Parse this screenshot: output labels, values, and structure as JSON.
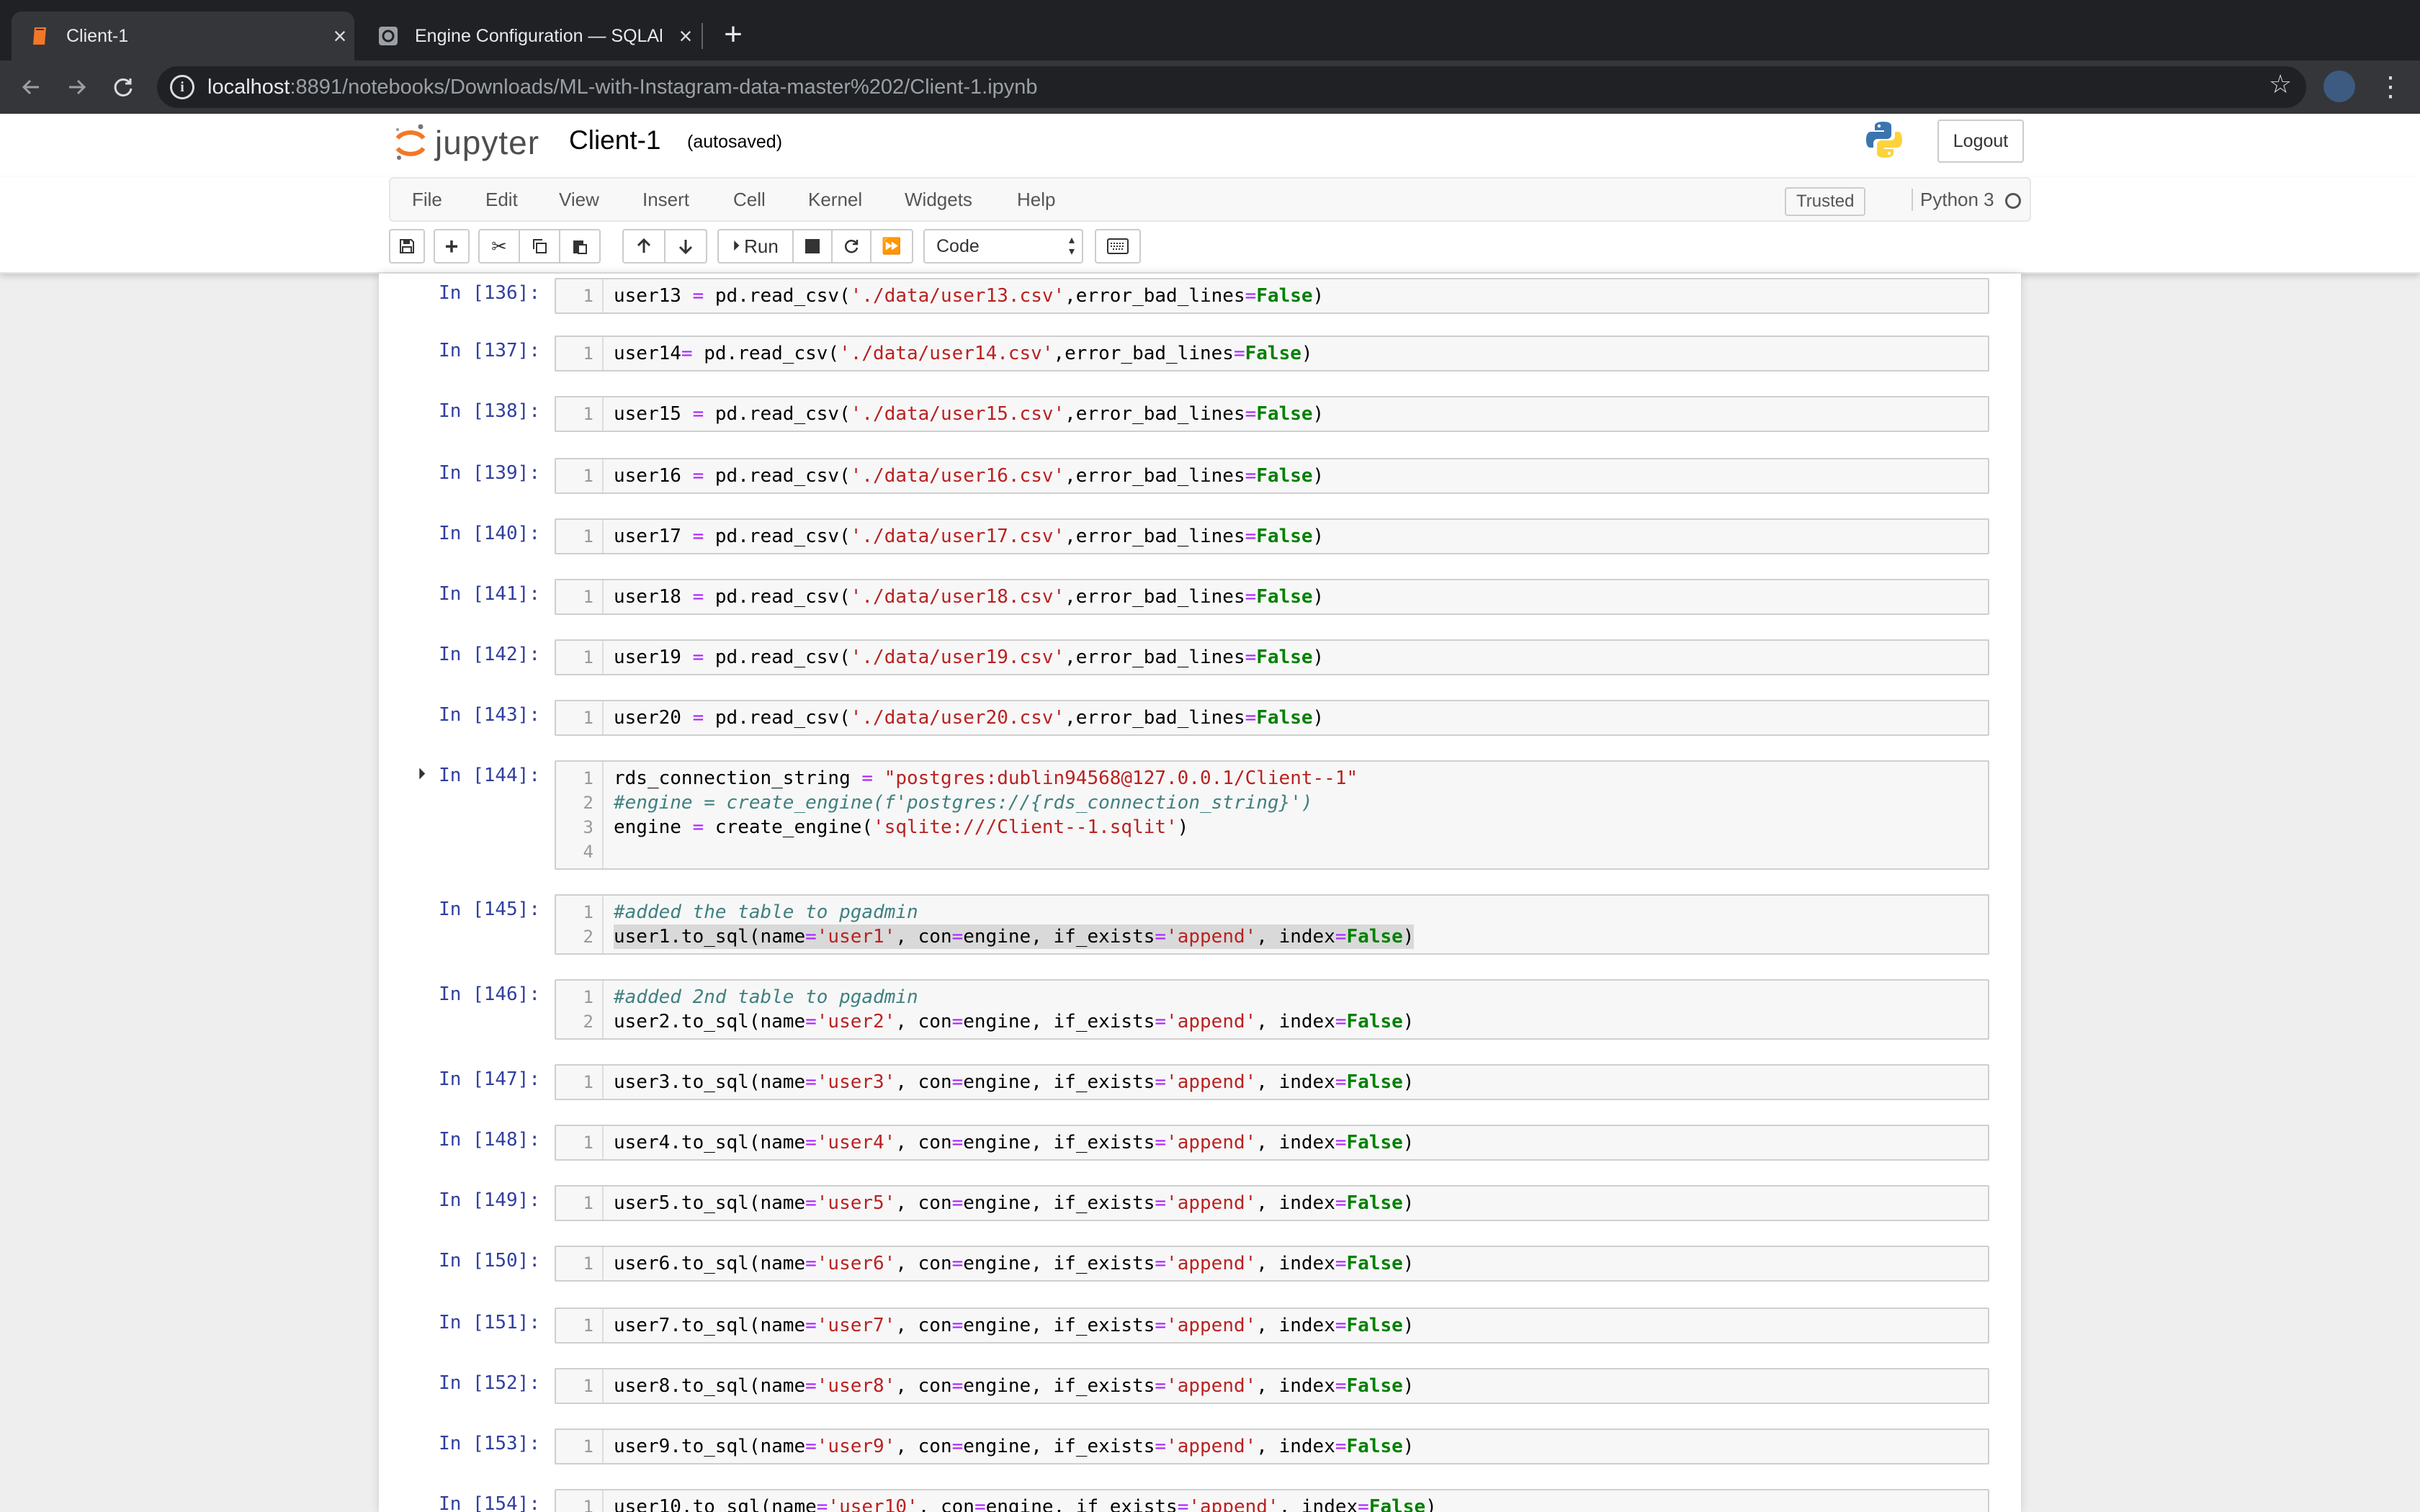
{
  "browser": {
    "tabs": [
      {
        "title": "Client-1",
        "active": true
      },
      {
        "title": "Engine Configuration — SQLAl",
        "active": false
      }
    ],
    "close_glyph": "×",
    "new_tab_glyph": "+",
    "url_host": "localhost",
    "url_path": ":8891/notebooks/Downloads/ML-with-Instagram-data-master%202/Client-1.ipynb"
  },
  "jupyter": {
    "logo_text": "jupyter",
    "notebook_name": "Client-1",
    "autosave_status": "(autosaved)",
    "logout_label": "Logout",
    "menu": [
      "File",
      "Edit",
      "View",
      "Insert",
      "Cell",
      "Kernel",
      "Widgets",
      "Help"
    ],
    "trusted_label": "Trusted",
    "kernel_name": "Python 3",
    "run_label": "Run",
    "cell_type": "Code"
  },
  "cells": [
    {
      "prompt": "In [136]:",
      "lines": [
        "user13 = pd.read_csv('./data/user13.csv',error_bad_lines=False)"
      ]
    },
    {
      "prompt": "In [137]:",
      "lines": [
        "user14= pd.read_csv('./data/user14.csv',error_bad_lines=False)"
      ]
    },
    {
      "prompt": "In [138]:",
      "lines": [
        "user15 = pd.read_csv('./data/user15.csv',error_bad_lines=False)"
      ]
    },
    {
      "prompt": "In [139]:",
      "lines": [
        "user16 = pd.read_csv('./data/user16.csv',error_bad_lines=False)"
      ]
    },
    {
      "prompt": "In [140]:",
      "lines": [
        "user17 = pd.read_csv('./data/user17.csv',error_bad_lines=False)"
      ]
    },
    {
      "prompt": "In [141]:",
      "lines": [
        "user18 = pd.read_csv('./data/user18.csv',error_bad_lines=False)"
      ]
    },
    {
      "prompt": "In [142]:",
      "lines": [
        "user19 = pd.read_csv('./data/user19.csv',error_bad_lines=False)"
      ]
    },
    {
      "prompt": "In [143]:",
      "lines": [
        "user20 = pd.read_csv('./data/user20.csv',error_bad_lines=False)"
      ]
    },
    {
      "prompt": "In [144]:",
      "running": true,
      "lines": [
        "rds_connection_string = \"postgres:dublin94568@127.0.0.1/Client--1\"",
        "#engine = create_engine(f'postgres://{rds_connection_string}')",
        "engine = create_engine('sqlite:///Client--1.sqlit')",
        ""
      ]
    },
    {
      "prompt": "In [145]:",
      "highlight_line": 1,
      "lines": [
        "#added the table to pgadmin",
        "user1.to_sql(name='user1', con=engine, if_exists='append', index=False)"
      ]
    },
    {
      "prompt": "In [146]:",
      "lines": [
        "#added 2nd table to pgadmin",
        "user2.to_sql(name='user2', con=engine, if_exists='append', index=False)"
      ]
    },
    {
      "prompt": "In [147]:",
      "lines": [
        "user3.to_sql(name='user3', con=engine, if_exists='append', index=False)"
      ]
    },
    {
      "prompt": "In [148]:",
      "lines": [
        "user4.to_sql(name='user4', con=engine, if_exists='append', index=False)"
      ]
    },
    {
      "prompt": "In [149]:",
      "lines": [
        "user5.to_sql(name='user5', con=engine, if_exists='append', index=False)"
      ]
    },
    {
      "prompt": "In [150]:",
      "lines": [
        "user6.to_sql(name='user6', con=engine, if_exists='append', index=False)"
      ]
    },
    {
      "prompt": "In [151]:",
      "lines": [
        "user7.to_sql(name='user7', con=engine, if_exists='append', index=False)"
      ]
    },
    {
      "prompt": "In [152]:",
      "lines": [
        "user8.to_sql(name='user8', con=engine, if_exists='append', index=False)"
      ]
    },
    {
      "prompt": "In [153]:",
      "lines": [
        "user9.to_sql(name='user9', con=engine, if_exists='append', index=False)"
      ]
    },
    {
      "prompt": "In [154]:",
      "lines": [
        "user10.to_sql(name='user10', con=engine, if_exists='append', index=False)"
      ]
    }
  ]
}
